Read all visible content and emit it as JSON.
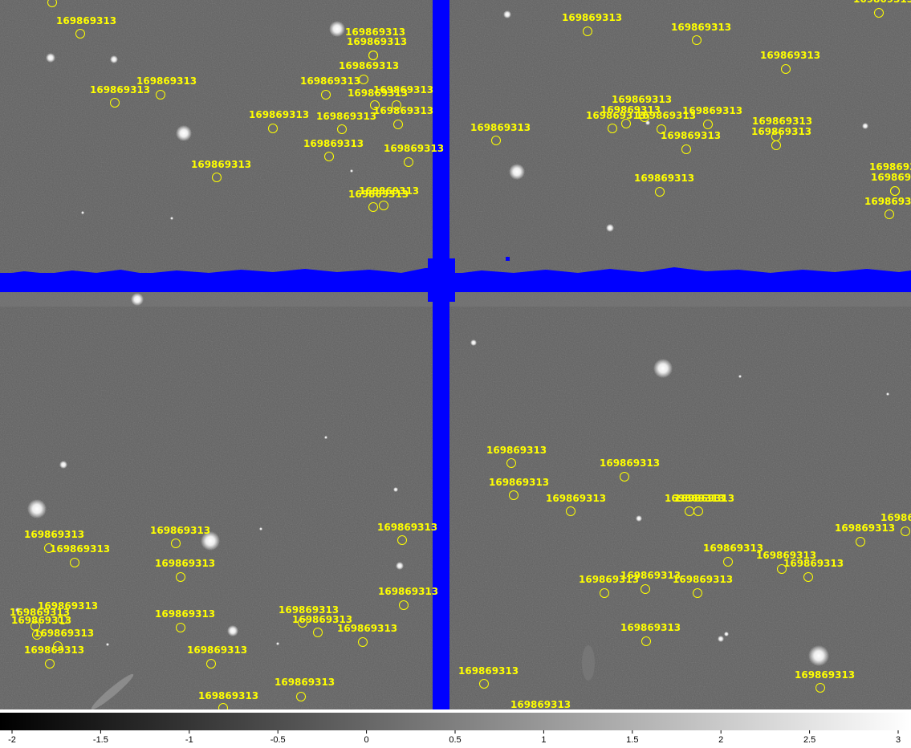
{
  "image": {
    "background_level": "#606060",
    "masked_color": "#0000ff",
    "region_color": "#ffff00"
  },
  "regions": {
    "label": "169869313",
    "count": 70
  },
  "colorbar": {
    "min": -2,
    "max": 3,
    "ticks": [
      "-2",
      "-1.5",
      "-1",
      "-0.5",
      "0",
      "0.5",
      "1",
      "1.5",
      "2",
      "2.5",
      "3"
    ],
    "colormap": "grey"
  }
}
